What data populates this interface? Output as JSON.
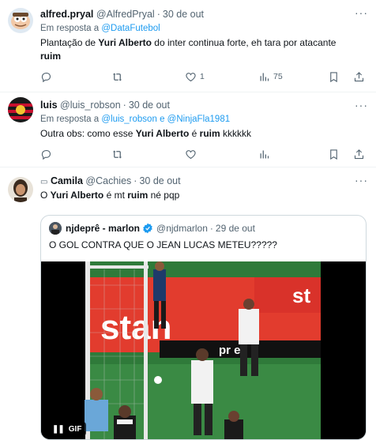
{
  "tweets": [
    {
      "display_name": "alfred.pryal",
      "handle": "@AlfredPryal",
      "date": "30 de out",
      "reply_prefix": "Em resposta a",
      "reply_to": "@DataFutebol",
      "text_1": "Plantação de ",
      "text_bold_1": "Yuri Alberto",
      "text_2": " do inter continua forte, eh tara por atacante",
      "text_bold_2": "ruim",
      "likes": "1",
      "views": "75"
    },
    {
      "display_name": "luis",
      "handle": "@luis_robson",
      "date": "30 de out",
      "reply_prefix": "Em resposta a",
      "reply_to_1": "@luis_robson",
      "reply_joiner": "e",
      "reply_to_2": "@NinjaFla1981",
      "text_1": "Outra obs: como esse ",
      "text_bold_1": "Yuri Alberto",
      "text_2": " é ",
      "text_bold_2": "ruim",
      "text_3": " kkkkkk"
    },
    {
      "display_name": "Camila",
      "handle": "@Cachies",
      "date": "30 de out",
      "text_1": "O ",
      "text_bold_1": "Yuri Alberto",
      "text_2": " é mt ",
      "text_bold_2": "ruim",
      "text_3": " né pqp"
    }
  ],
  "quote": {
    "display_name": "njdeprê - marlon",
    "handle": "@njdmarlon",
    "date": "29 de out",
    "text": "O GOL CONTRA QUE O JEAN LUCAS METEU?????",
    "media_badge": "GIF",
    "media_board_text_1": "stan",
    "media_board_text_2": "st",
    "media_board_text_3": "pr   et"
  },
  "icons": {
    "reply": "reply-icon",
    "retweet": "retweet-icon",
    "like": "heart-icon",
    "views": "views-icon",
    "bookmark": "bookmark-icon",
    "share": "share-icon"
  },
  "colors": {
    "accent": "#1d9bf0",
    "secondary_text": "#536471",
    "border": "#eff3f4"
  }
}
